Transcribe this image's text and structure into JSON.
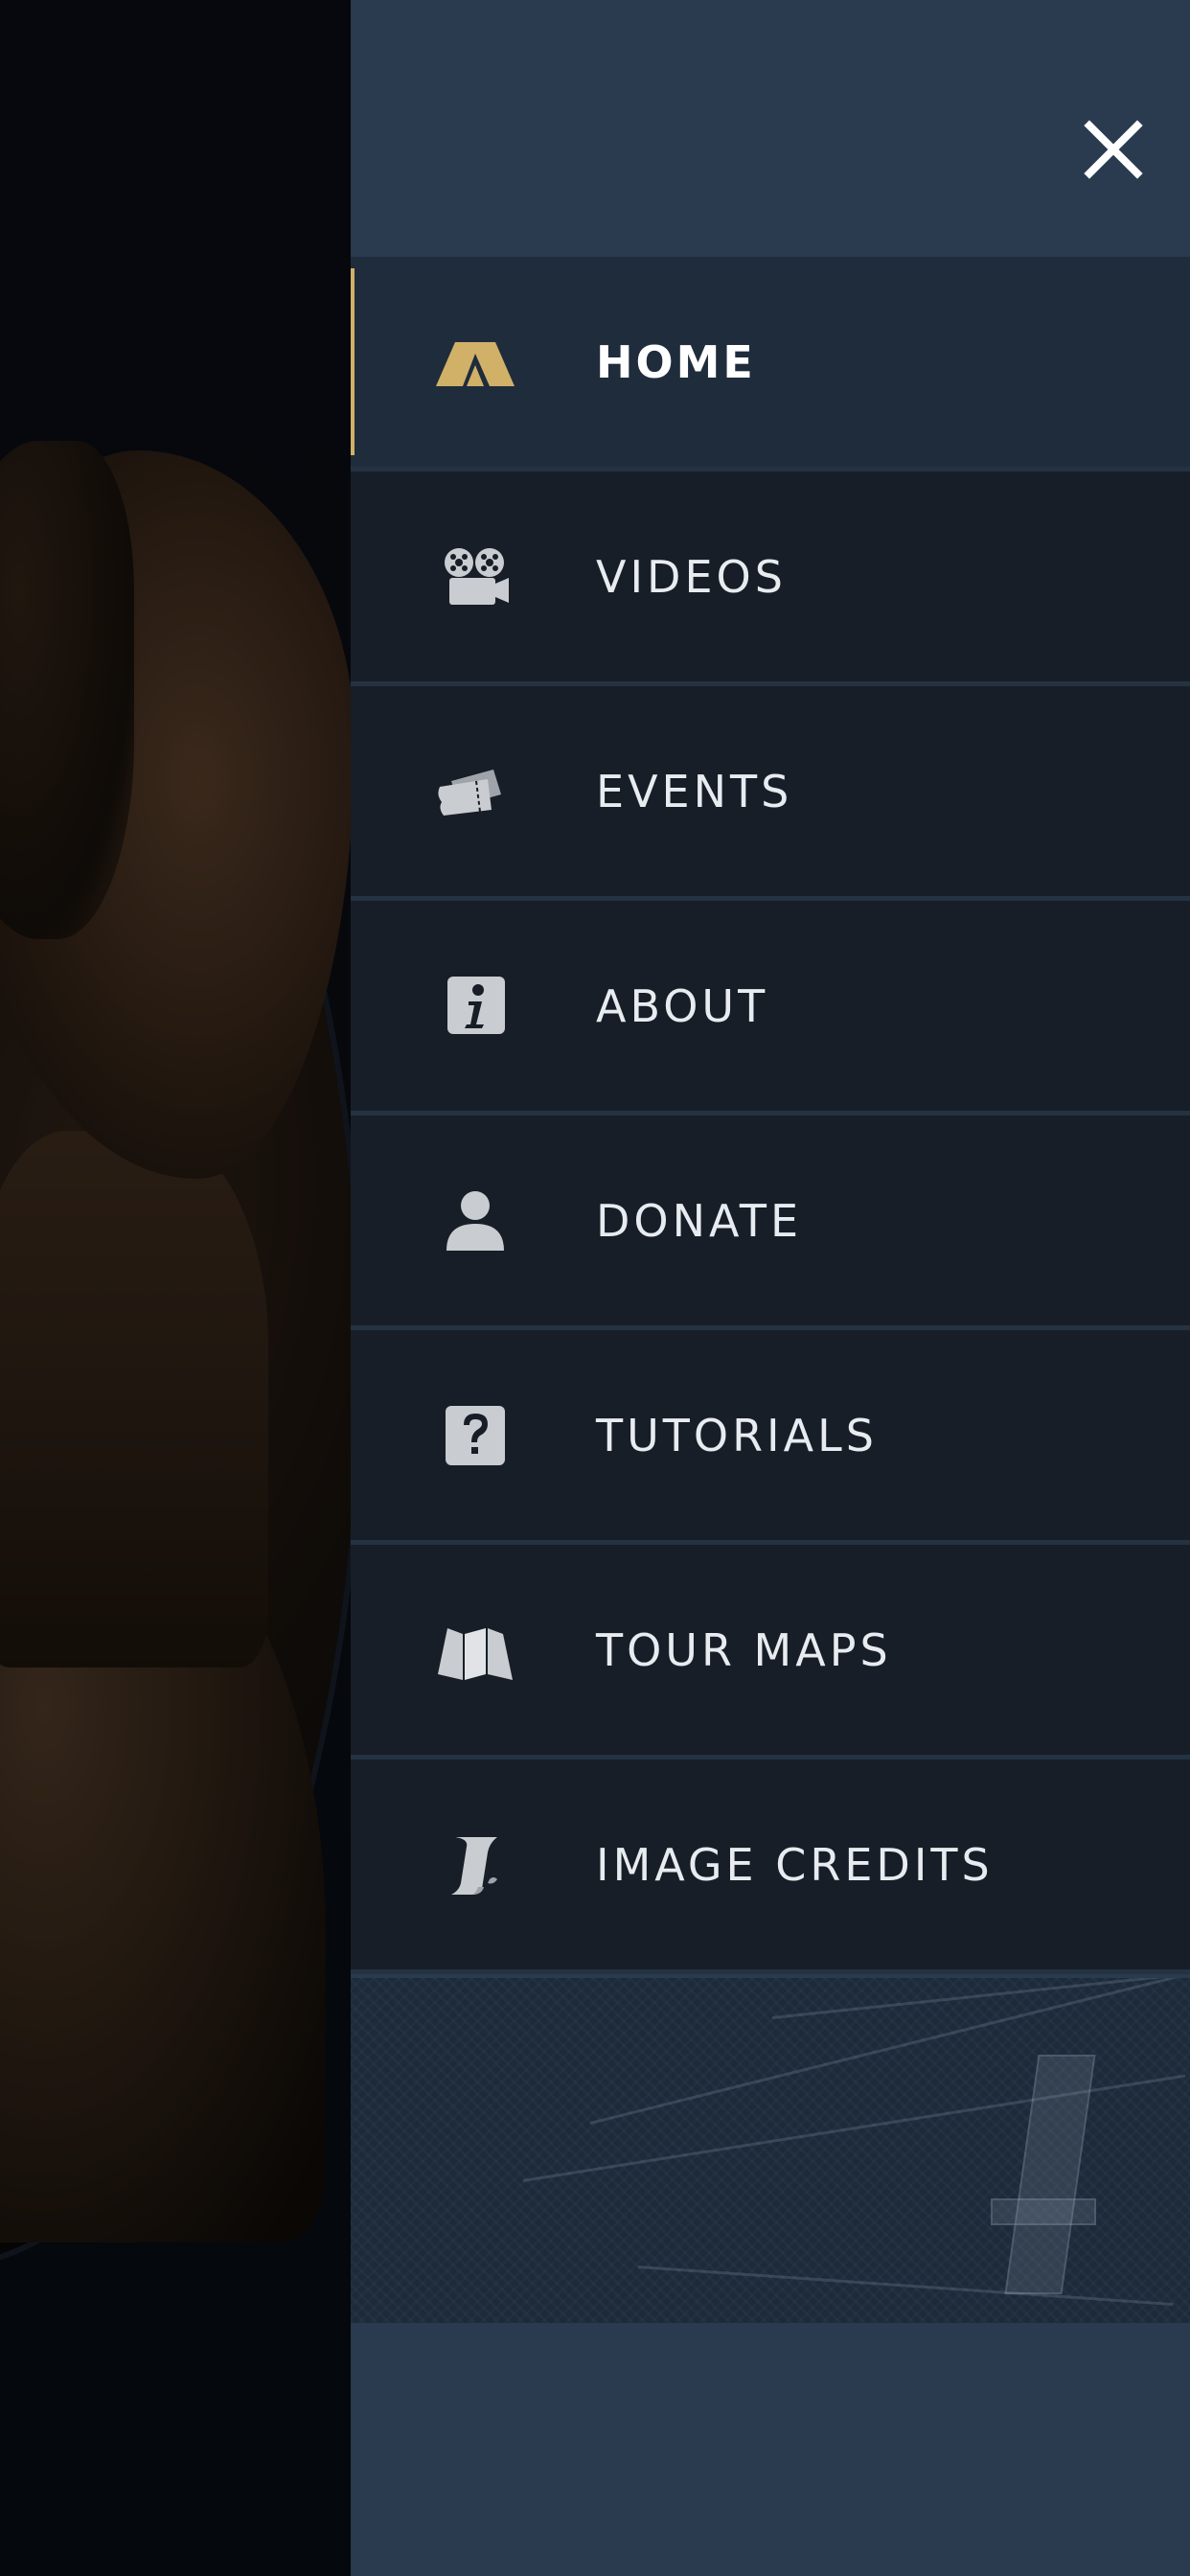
{
  "drawer": {
    "close_icon": "close-icon",
    "items": [
      {
        "label": "HOME",
        "icon": "tent-icon",
        "active": true
      },
      {
        "label": "VIDEOS",
        "icon": "film-projector-icon",
        "active": false
      },
      {
        "label": "EVENTS",
        "icon": "tickets-icon",
        "active": false
      },
      {
        "label": "ABOUT",
        "icon": "info-icon",
        "active": false
      },
      {
        "label": "DONATE",
        "icon": "person-icon",
        "active": false
      },
      {
        "label": "TUTORIALS",
        "icon": "question-icon",
        "active": false
      },
      {
        "label": "TOUR MAPS",
        "icon": "map-icon",
        "active": false
      },
      {
        "label": "IMAGE CREDITS",
        "icon": "scroll-icon",
        "active": false
      }
    ]
  },
  "colors": {
    "drawer_bg": "#2a3a4f",
    "item_bg": "#171e27",
    "active_bg": "#1f2c3c",
    "accent_gold": "#d1b068",
    "icon_gray": "#c9ccd0",
    "label": "#e8ecf0"
  }
}
